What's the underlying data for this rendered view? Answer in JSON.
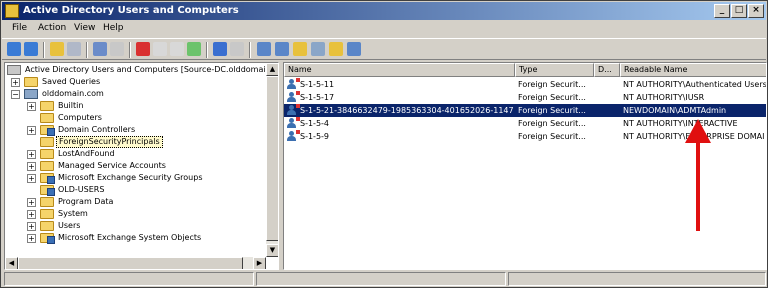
{
  "window": {
    "title": "Active Directory Users and Computers",
    "controls": [
      "_",
      "□",
      "×"
    ]
  },
  "menu": [
    "File",
    "Action",
    "View",
    "Help"
  ],
  "toolbar_icons": [
    "back-icon",
    "forward-icon",
    "up-icon",
    "properties-icon",
    "cut-icon",
    "copy-icon",
    "delete-icon",
    "properties-sheet-icon",
    "refresh-icon",
    "export-icon",
    "help-icon",
    "console-icon",
    "new-user-icon",
    "new-group-icon",
    "new-ou-icon",
    "filter-icon",
    "find-icon",
    "add-to-group-icon"
  ],
  "tree": [
    {
      "label": "Active Directory Users and Computers [Source-DC.olddomain.c",
      "level": 0,
      "expander": "",
      "icon": "root"
    },
    {
      "label": "Saved Queries",
      "level": 1,
      "expander": "+",
      "icon": "folder"
    },
    {
      "label": "olddomain.com",
      "level": 1,
      "expander": "−",
      "icon": "domain"
    },
    {
      "label": "Builtin",
      "level": 2,
      "expander": "+",
      "icon": "folder"
    },
    {
      "label": "Computers",
      "level": 2,
      "expander": "",
      "icon": "folder"
    },
    {
      "label": "Domain Controllers",
      "level": 2,
      "expander": "+",
      "icon": "ou"
    },
    {
      "label": "ForeignSecurityPrincipals",
      "level": 2,
      "expander": "",
      "icon": "folder",
      "selected": true
    },
    {
      "label": "LostAndFound",
      "level": 2,
      "expander": "+",
      "icon": "folder"
    },
    {
      "label": "Managed Service Accounts",
      "level": 2,
      "expander": "+",
      "icon": "folder"
    },
    {
      "label": "Microsoft Exchange Security Groups",
      "level": 2,
      "expander": "+",
      "icon": "ou"
    },
    {
      "label": "OLD-USERS",
      "level": 2,
      "expander": "",
      "icon": "ou"
    },
    {
      "label": "Program Data",
      "level": 2,
      "expander": "+",
      "icon": "folder"
    },
    {
      "label": "System",
      "level": 2,
      "expander": "+",
      "icon": "folder"
    },
    {
      "label": "Users",
      "level": 2,
      "expander": "+",
      "icon": "folder"
    },
    {
      "label": "Microsoft Exchange System Objects",
      "level": 2,
      "expander": "+",
      "icon": "ou"
    }
  ],
  "list": {
    "columns": [
      "Name",
      "Type",
      "D...",
      "Readable Name"
    ],
    "rows": [
      {
        "name": "S-1-5-11",
        "type": "Foreign Securit...",
        "desc": "",
        "readable": "NT AUTHORITY\\Authenticated Users"
      },
      {
        "name": "S-1-5-17",
        "type": "Foreign Securit...",
        "desc": "",
        "readable": "NT AUTHORITY\\IUSR"
      },
      {
        "name": "S-1-5-21-3846632479-1985363304-401652026-1147",
        "type": "Foreign Securit...",
        "desc": "",
        "readable": "NEWDOMAIN\\ADMTAdmin",
        "selected": true
      },
      {
        "name": "S-1-5-4",
        "type": "Foreign Securit...",
        "desc": "",
        "readable": "NT AUTHORITY\\INTERACTIVE"
      },
      {
        "name": "S-1-5-9",
        "type": "Foreign Securit...",
        "desc": "",
        "readable": "NT AUTHORITY\\ENTERPRISE DOMAI"
      }
    ]
  },
  "colors": {
    "selection": "#0a246a",
    "annotation_arrow": "#e01010"
  }
}
